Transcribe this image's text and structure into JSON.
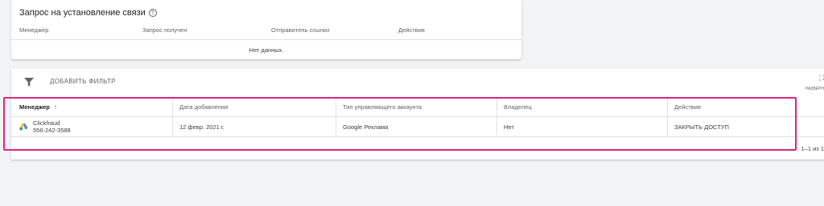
{
  "connection_requests": {
    "title": "Запрос на установление связи",
    "columns": [
      "Менеджер",
      "Запрос получен",
      "Отправитель ссылки",
      "Действия"
    ],
    "empty_text": "Нет данных."
  },
  "toolbar": {
    "add_filter_label": "ДОБАВИТЬ ФИЛЬТР",
    "expand_label": "РАЗВЕРН"
  },
  "accounts_table": {
    "columns": [
      "Менеджер",
      "Дата добавления",
      "Тип управляющего аккаунта",
      "Владелец",
      "Действия"
    ],
    "rows": [
      {
        "name": "Clickfraud",
        "id": "556-242-3588",
        "date_added": "12 февр. 2021 г.",
        "account_type": "Google Реклама",
        "owner": "Нет",
        "action": "ЗАКРЫТЬ ДОСТУП"
      }
    ]
  },
  "pagination": "1–1 из 1",
  "colors": {
    "highlight": "#e0247f",
    "background": "#f1f3f4"
  },
  "icons": [
    "help-icon",
    "filter-icon",
    "expand-icon",
    "sort-arrow-up-icon",
    "google-ads-icon"
  ]
}
